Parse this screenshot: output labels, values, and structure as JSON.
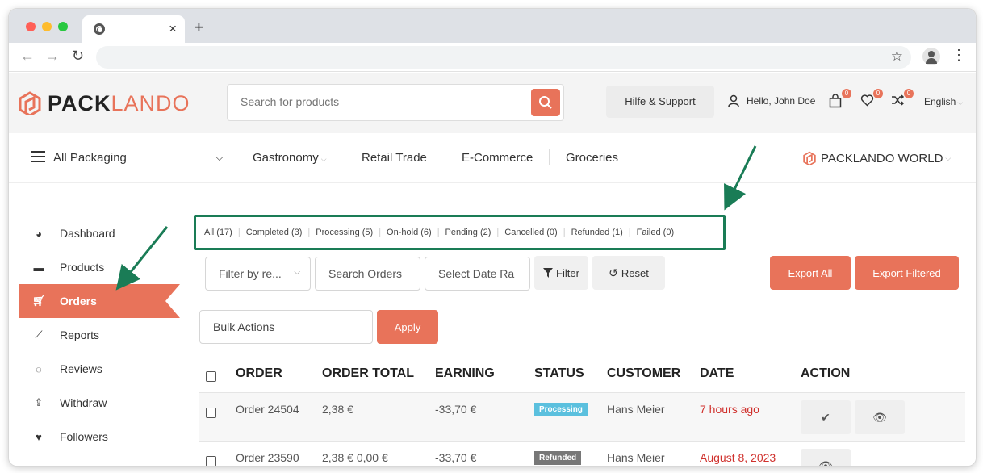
{
  "browser": {
    "tab_close": "×",
    "new_tab": "+",
    "back": "←",
    "forward": "→",
    "reload": "↻",
    "star": "☆",
    "menu": "⋮"
  },
  "header": {
    "logo_pack": "PACK",
    "logo_lando": "LANDO",
    "search_placeholder": "Search for products",
    "help_label": "Hilfe & Support",
    "user_greeting": "Hello, John Doe",
    "cart_count": "0",
    "wishlist_count": "0",
    "compare_count": "0",
    "language": "English",
    "accent_color": "#e8735a"
  },
  "catnav": {
    "all_packaging": "All Packaging",
    "chevron": "⌵",
    "categories": [
      "Gastronomy",
      "Retail Trade",
      "E-Commerce",
      "Groceries"
    ],
    "world": "PACKLANDO WORLD"
  },
  "sidebar": {
    "items": [
      {
        "label": "Dashboard",
        "icon": "gauge-icon"
      },
      {
        "label": "Products",
        "icon": "briefcase-icon"
      },
      {
        "label": "Orders",
        "icon": "cart-icon"
      },
      {
        "label": "Reports",
        "icon": "chart-icon"
      },
      {
        "label": "Reviews",
        "icon": "comments-icon"
      },
      {
        "label": "Withdraw",
        "icon": "upload-icon"
      },
      {
        "label": "Followers",
        "icon": "heart-icon"
      }
    ]
  },
  "status_filters": [
    "All (17)",
    "Completed (3)",
    "Processing (5)",
    "On-hold (6)",
    "Pending (2)",
    "Cancelled (0)",
    "Refunded (1)",
    "Failed (0)"
  ],
  "toolbar": {
    "filter_by_placeholder": "Filter by re...",
    "search_orders_placeholder": "Search Orders",
    "date_range_placeholder": "Select Date Ra",
    "filter_label": "Filter",
    "reset_label": "Reset",
    "export_all": "Export All",
    "export_filtered": "Export Filtered",
    "bulk_actions": "Bulk Actions",
    "apply": "Apply"
  },
  "table": {
    "columns": [
      "ORDER",
      "ORDER TOTAL",
      "EARNING",
      "STATUS",
      "CUSTOMER",
      "DATE",
      "ACTION"
    ],
    "rows": [
      {
        "order": "Order 24504",
        "total_old": "",
        "total": "2,38 €",
        "earning": "-33,70 €",
        "status": "Processing",
        "customer": "Hans Meier",
        "date": "7 hours ago"
      },
      {
        "order": "Order 23590",
        "total_old": "2,38 €",
        "total": "0,00 €",
        "earning": "-33,70 €",
        "status": "Refunded",
        "customer": "Hans Meier",
        "date": "August 8, 2023"
      }
    ]
  }
}
